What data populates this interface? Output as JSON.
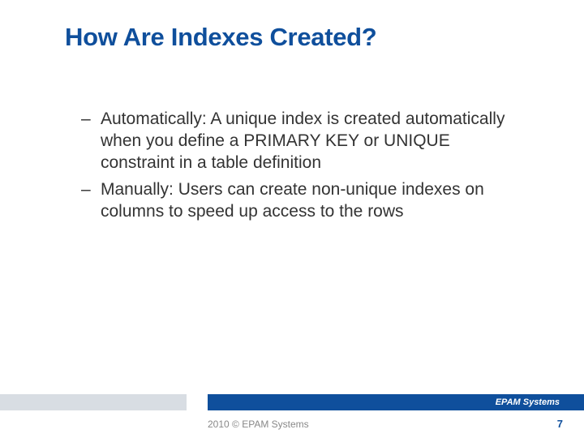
{
  "title": "How Are Indexes Created?",
  "bullets": [
    "Automatically: A unique index is created automatically when you define a PRIMARY KEY or UNIQUE constraint in a table definition",
    "Manually: Users can create non-unique indexes on columns to speed up access to the rows"
  ],
  "footer": {
    "logo_text": "EPAM Systems",
    "copyright": "2010 © EPAM Systems",
    "page_number": "7"
  },
  "colors": {
    "title": "#0f4f9c",
    "footer_bar": "#0f4f9c",
    "footer_left": "#d8dde3"
  }
}
